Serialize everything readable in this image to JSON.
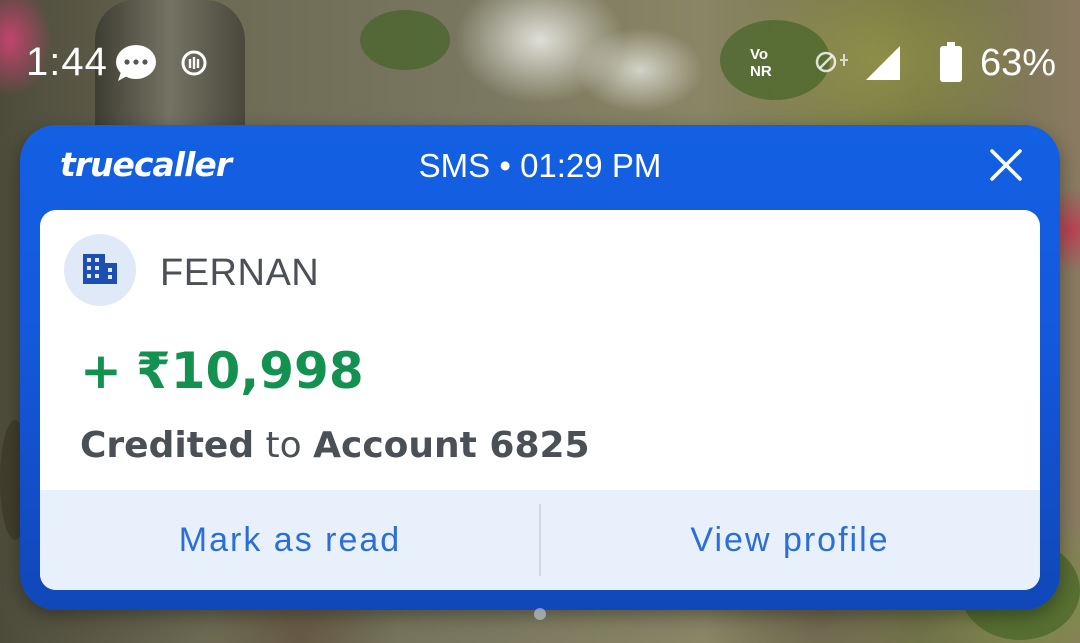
{
  "status_bar": {
    "time": "1:44",
    "volte_line1": "Vo",
    "volte_line2": "NR",
    "battery_percent": "63%",
    "icons": [
      "chat-bubble-icon",
      "app-notification-icon",
      "volte-icon",
      "mobile-data-icon",
      "signal-icon",
      "battery-icon"
    ]
  },
  "popup": {
    "brand": "truecaller",
    "header_meta": "SMS • 01:29 PM",
    "close_icon": "close-icon",
    "sender": {
      "name": "FERNAN",
      "avatar_icon": "business-building-icon"
    },
    "amount": {
      "sign": "+",
      "value": "₹10,998"
    },
    "description": {
      "part1": "Credited",
      "part2": " to ",
      "part3": "Account 6825"
    },
    "actions": {
      "mark_read": "Mark as read",
      "view_profile": "View profile"
    }
  },
  "colors": {
    "popup_blue": "#1360e2",
    "amount_green": "#129150",
    "action_text": "#2b6fd6",
    "action_bg": "#e8f1fb"
  }
}
